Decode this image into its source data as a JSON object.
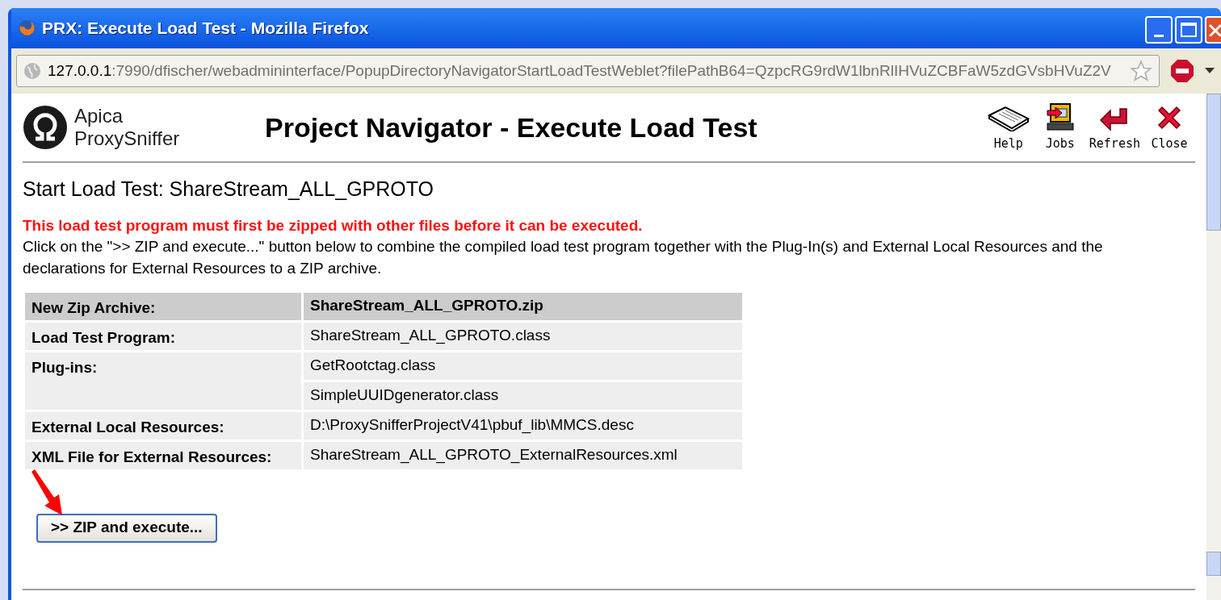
{
  "window": {
    "title": "PRX: Execute Load Test - Mozilla Firefox"
  },
  "address_bar": {
    "host": "127.0.0.1",
    "path": ":7990/dfischer/webadmininterface/PopupDirectoryNavigatorStartLoadTestWeblet?filePathB64=QzpcRG9rdW1lbnRlIHVuZCBFaW5zdGVsbHVuZ2V",
    "starred": false
  },
  "logo": {
    "lines": [
      "Apica",
      "ProxySniffer"
    ]
  },
  "page_title": "Project Navigator - Execute Load Test",
  "toolbar": [
    {
      "label": "Help",
      "kind": "book"
    },
    {
      "label": "Jobs",
      "kind": "jobs"
    },
    {
      "label": "Refresh",
      "kind": "back"
    },
    {
      "label": "Close",
      "kind": "close"
    }
  ],
  "heading": "Start Load Test: ShareStream_ALL_GPROTO",
  "warning": "This load test program must first be zipped with other files before it can be executed.",
  "description": "Click on the \">> ZIP and execute...\" button below to combine the compiled load test program together with the Plug-In(s) and External Local Resources and the declarations for External Resources to a ZIP archive.",
  "table": {
    "rows": [
      {
        "kind": "header",
        "label": "New Zip Archive:",
        "values": [
          "ShareStream_ALL_GPROTO.zip"
        ]
      },
      {
        "kind": "normal",
        "label": "Load Test Program:",
        "values": [
          "ShareStream_ALL_GPROTO.class"
        ]
      },
      {
        "kind": "normal",
        "label": "Plug-ins:",
        "values": [
          "GetRootctag.class",
          "SimpleUUIDgenerator.class"
        ]
      },
      {
        "kind": "normal",
        "label": "External Local Resources:",
        "values": [
          "D:\\ProxySnifferProjectV41\\pbuf_lib\\MMCS.desc"
        ]
      },
      {
        "kind": "normal",
        "label": "XML File for External Resources:",
        "values": [
          "ShareStream_ALL_GPROTO_ExternalResources.xml"
        ]
      }
    ]
  },
  "zip_button": {
    "label": ">> ZIP and execute..."
  }
}
